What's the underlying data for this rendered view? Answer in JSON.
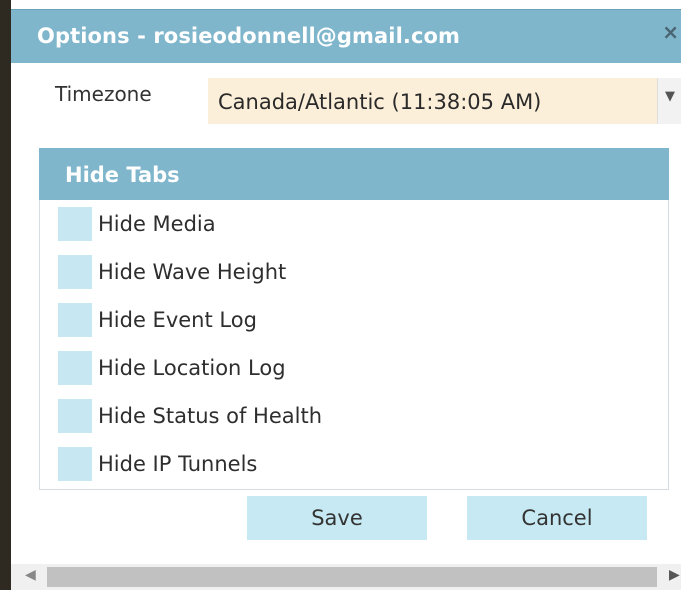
{
  "dialog": {
    "title": "Options - rosieodonnell@gmail.com",
    "close_icon": "×"
  },
  "timezone": {
    "label": "Timezone",
    "selected": "Canada/Atlantic (11:38:05 AM)",
    "arrow": "▼"
  },
  "hide_tabs": {
    "title": "Hide Tabs",
    "items": [
      {
        "label": "Hide Media",
        "checked": false
      },
      {
        "label": "Hide Wave Height",
        "checked": false
      },
      {
        "label": "Hide Event Log",
        "checked": false
      },
      {
        "label": "Hide Location Log",
        "checked": false
      },
      {
        "label": "Hide Status of Health",
        "checked": false
      },
      {
        "label": "Hide IP Tunnels",
        "checked": false
      }
    ]
  },
  "buttons": {
    "save": "Save",
    "cancel": "Cancel"
  },
  "scrollbar": {
    "left_arrow": "◀",
    "right_arrow": "▶"
  },
  "colors": {
    "header": "#7fb6cc",
    "checkbox": "#c7e8f2",
    "button": "#c6e9f3",
    "select_bg": "#fcefd9"
  }
}
